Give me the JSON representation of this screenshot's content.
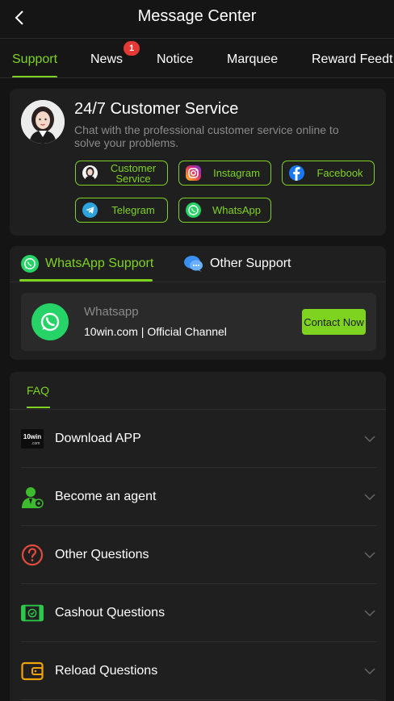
{
  "header": {
    "title": "Message Center"
  },
  "tabs": [
    {
      "label": "Support",
      "active": true
    },
    {
      "label": "News",
      "badge": "1"
    },
    {
      "label": "Notice"
    },
    {
      "label": "Marquee"
    },
    {
      "label": "Reward Feedt"
    }
  ],
  "customer_service": {
    "title": "24/7 Customer Service",
    "description": "Chat with the professional customer service online to solve your problems.",
    "channels": [
      {
        "label": "Customer Service",
        "icon": "avatar-icon"
      },
      {
        "label": "Instagram",
        "icon": "instagram-icon"
      },
      {
        "label": "Facebook",
        "icon": "facebook-icon"
      },
      {
        "label": "Telegram",
        "icon": "telegram-icon"
      },
      {
        "label": "WhatsApp",
        "icon": "whatsapp-icon"
      }
    ]
  },
  "support": {
    "tabs": [
      {
        "label": "WhatsApp Support",
        "active": true
      },
      {
        "label": "Other Support"
      }
    ],
    "whatsapp": {
      "name": "Whatsapp",
      "channel": "10win.com | Official Channel",
      "button": "Contact Now"
    }
  },
  "faq": {
    "tab": "FAQ",
    "items": [
      {
        "label": "Download APP",
        "icon": "10win-logo-icon"
      },
      {
        "label": "Become an agent",
        "icon": "agent-icon"
      },
      {
        "label": "Other Questions",
        "icon": "question-icon"
      },
      {
        "label": "Cashout Questions",
        "icon": "cash-icon"
      },
      {
        "label": "Reload Questions",
        "icon": "wallet-icon"
      }
    ]
  },
  "colors": {
    "accent": "#7ed321",
    "badge": "#e53935",
    "background": "#141414",
    "card": "#1f1f1f"
  }
}
